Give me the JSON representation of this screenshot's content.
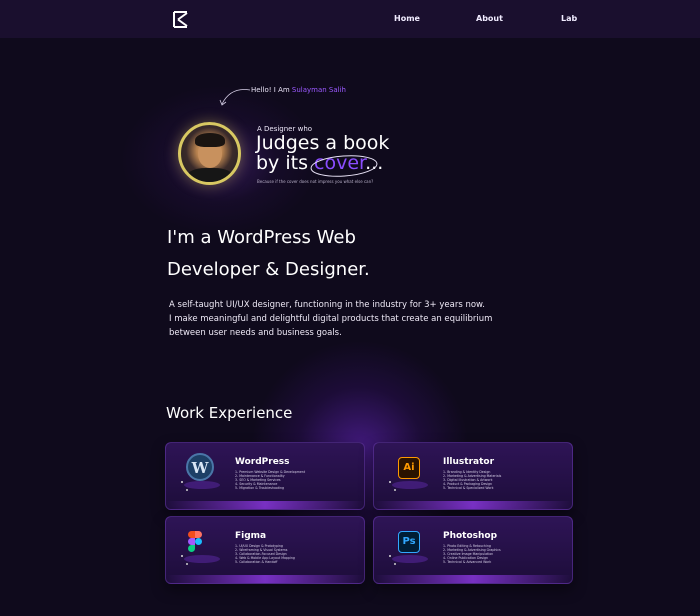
{
  "nav": {
    "links": [
      "Home",
      "About",
      "Lab"
    ]
  },
  "hero": {
    "hello_prefix": "Hello! I Am",
    "hello_name": "Sulayman Salih",
    "designer_line": "A Designer who",
    "judges_line1": "Judges a book",
    "judges_line2_prefix": "by its",
    "judges_cover": "cover",
    "judges_suffix": "...",
    "because_line": "Because if the cover does not impress you what else can?"
  },
  "headline": {
    "line1": "I'm a WordPress Web",
    "line2": "Developer & Designer."
  },
  "bio": {
    "line1": "A self-taught UI/UX designer, functioning in the industry for 3+ years now.",
    "line2": "I make meaningful and delightful digital products that create an equilibrium",
    "line3": "between user needs and business goals."
  },
  "work": {
    "title": "Work Experience",
    "cards": [
      {
        "title": "WordPress",
        "icon": "wordpress-icon",
        "items": [
          "1- Premium Website Design & Development",
          "2- Maintenance & Functionality",
          "3- SEO & Marketing Services",
          "4- Security & Maintenance",
          "5- Migration & Troubleshooting"
        ]
      },
      {
        "title": "Illustrator",
        "icon": "illustrator-icon",
        "items": [
          "1- Branding & Identity Design",
          "2- Marketing & Advertising Materials",
          "3- Digital Illustration & Artwork",
          "4- Product & Packaging Design",
          "5- Technical & Specialized Work"
        ]
      },
      {
        "title": "Figma",
        "icon": "figma-icon",
        "items": [
          "1- UI/UX Design & Prototyping",
          "2- Wireframing & Visual Systems",
          "3- Collaboration-Focused Design",
          "4- Web & Mobile App Layout Mapping",
          "5- Collaboration & Handoff"
        ]
      },
      {
        "title": "Photoshop",
        "icon": "photoshop-icon",
        "items": [
          "1- Photo Editing & Retouching",
          "2- Marketing & Advertising Graphics",
          "3- Creative Image Manipulation",
          "4- Online Publication Design",
          "5- Technical & Advanced Work"
        ]
      }
    ]
  },
  "colors": {
    "background": "#0f0a1c",
    "nav_background": "#1a0f2e",
    "accent": "#8a4dff",
    "card_background": "#2e1456"
  }
}
